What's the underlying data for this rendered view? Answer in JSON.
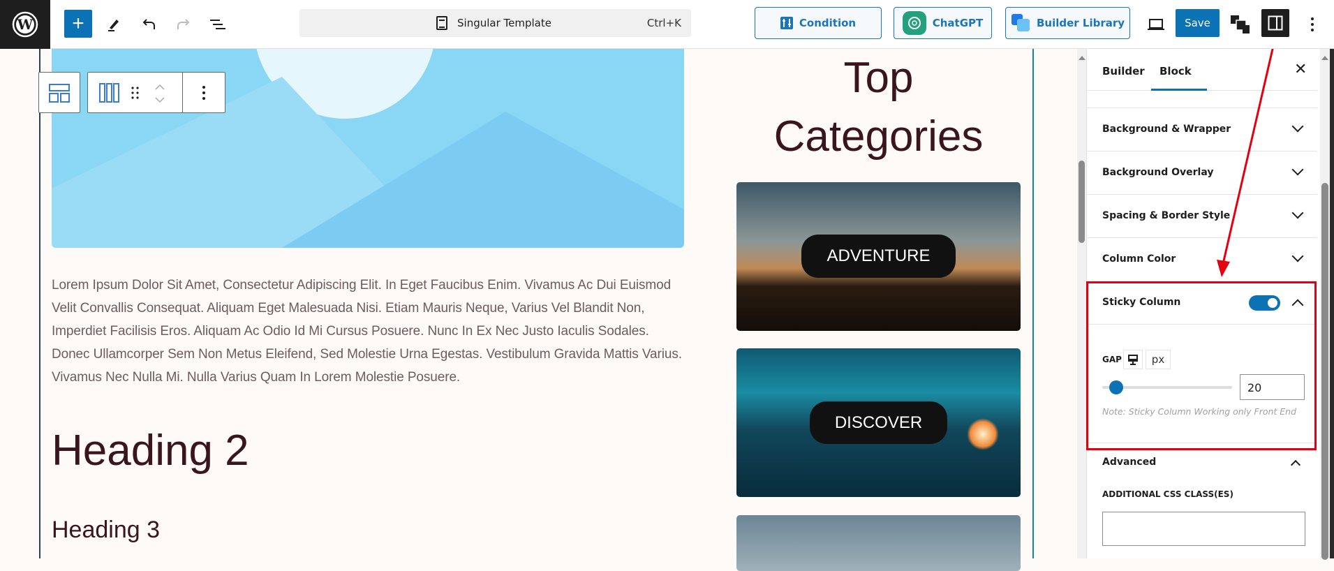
{
  "topbar": {
    "command_title": "Singular Template",
    "shortcut": "Ctrl+K",
    "condition": "Condition",
    "chatgpt": "ChatGPT",
    "builder_library": "Builder Library",
    "save": "Save"
  },
  "content": {
    "paragraph": "Lorem Ipsum Dolor Sit Amet, Consectetur Adipiscing Elit. In Eget Faucibus Enim. Vivamus Ac Dui Euismod Velit Convallis Consequat. Aliquam Eget Malesuada Nisi. Etiam Mauris Neque, Varius Vel Blandit Non, Imperdiet Facilisis Eros. Aliquam Ac Odio Id Mi Cursus Posuere. Nunc In Ex Nec Justo Iaculis Sodales. Donec Ullamcorper Sem Non Metus Eleifend, Sed Molestie Urna Egestas. Vestibulum Gravida Mattis Varius. Vivamus Nec Nulla Mi. Nulla Varius Quam In Lorem Molestie Posuere.",
    "heading2": "Heading 2",
    "heading3": "Heading 3",
    "right_title_1": "Top",
    "right_title_2": "Categories",
    "cards": [
      {
        "label": "ADVENTURE"
      },
      {
        "label": "DISCOVER"
      }
    ]
  },
  "sidebar": {
    "tabs": [
      "Builder",
      "Block"
    ],
    "active_tab": "Block",
    "panels": [
      "Background & Wrapper",
      "Background Overlay",
      "Spacing & Border Style",
      "Column Color"
    ],
    "sticky": {
      "title": "Sticky Column",
      "enabled": true,
      "gap_label": "GAP",
      "unit": "px",
      "gap_value": "20",
      "note": "Note: Sticky Column Working only Front End"
    },
    "advanced": {
      "title": "Advanced",
      "css_label": "ADDITIONAL CSS CLASS(ES)",
      "css_value": ""
    }
  },
  "colors": {
    "accent": "#0a72b5",
    "highlight": "#e3000f"
  }
}
